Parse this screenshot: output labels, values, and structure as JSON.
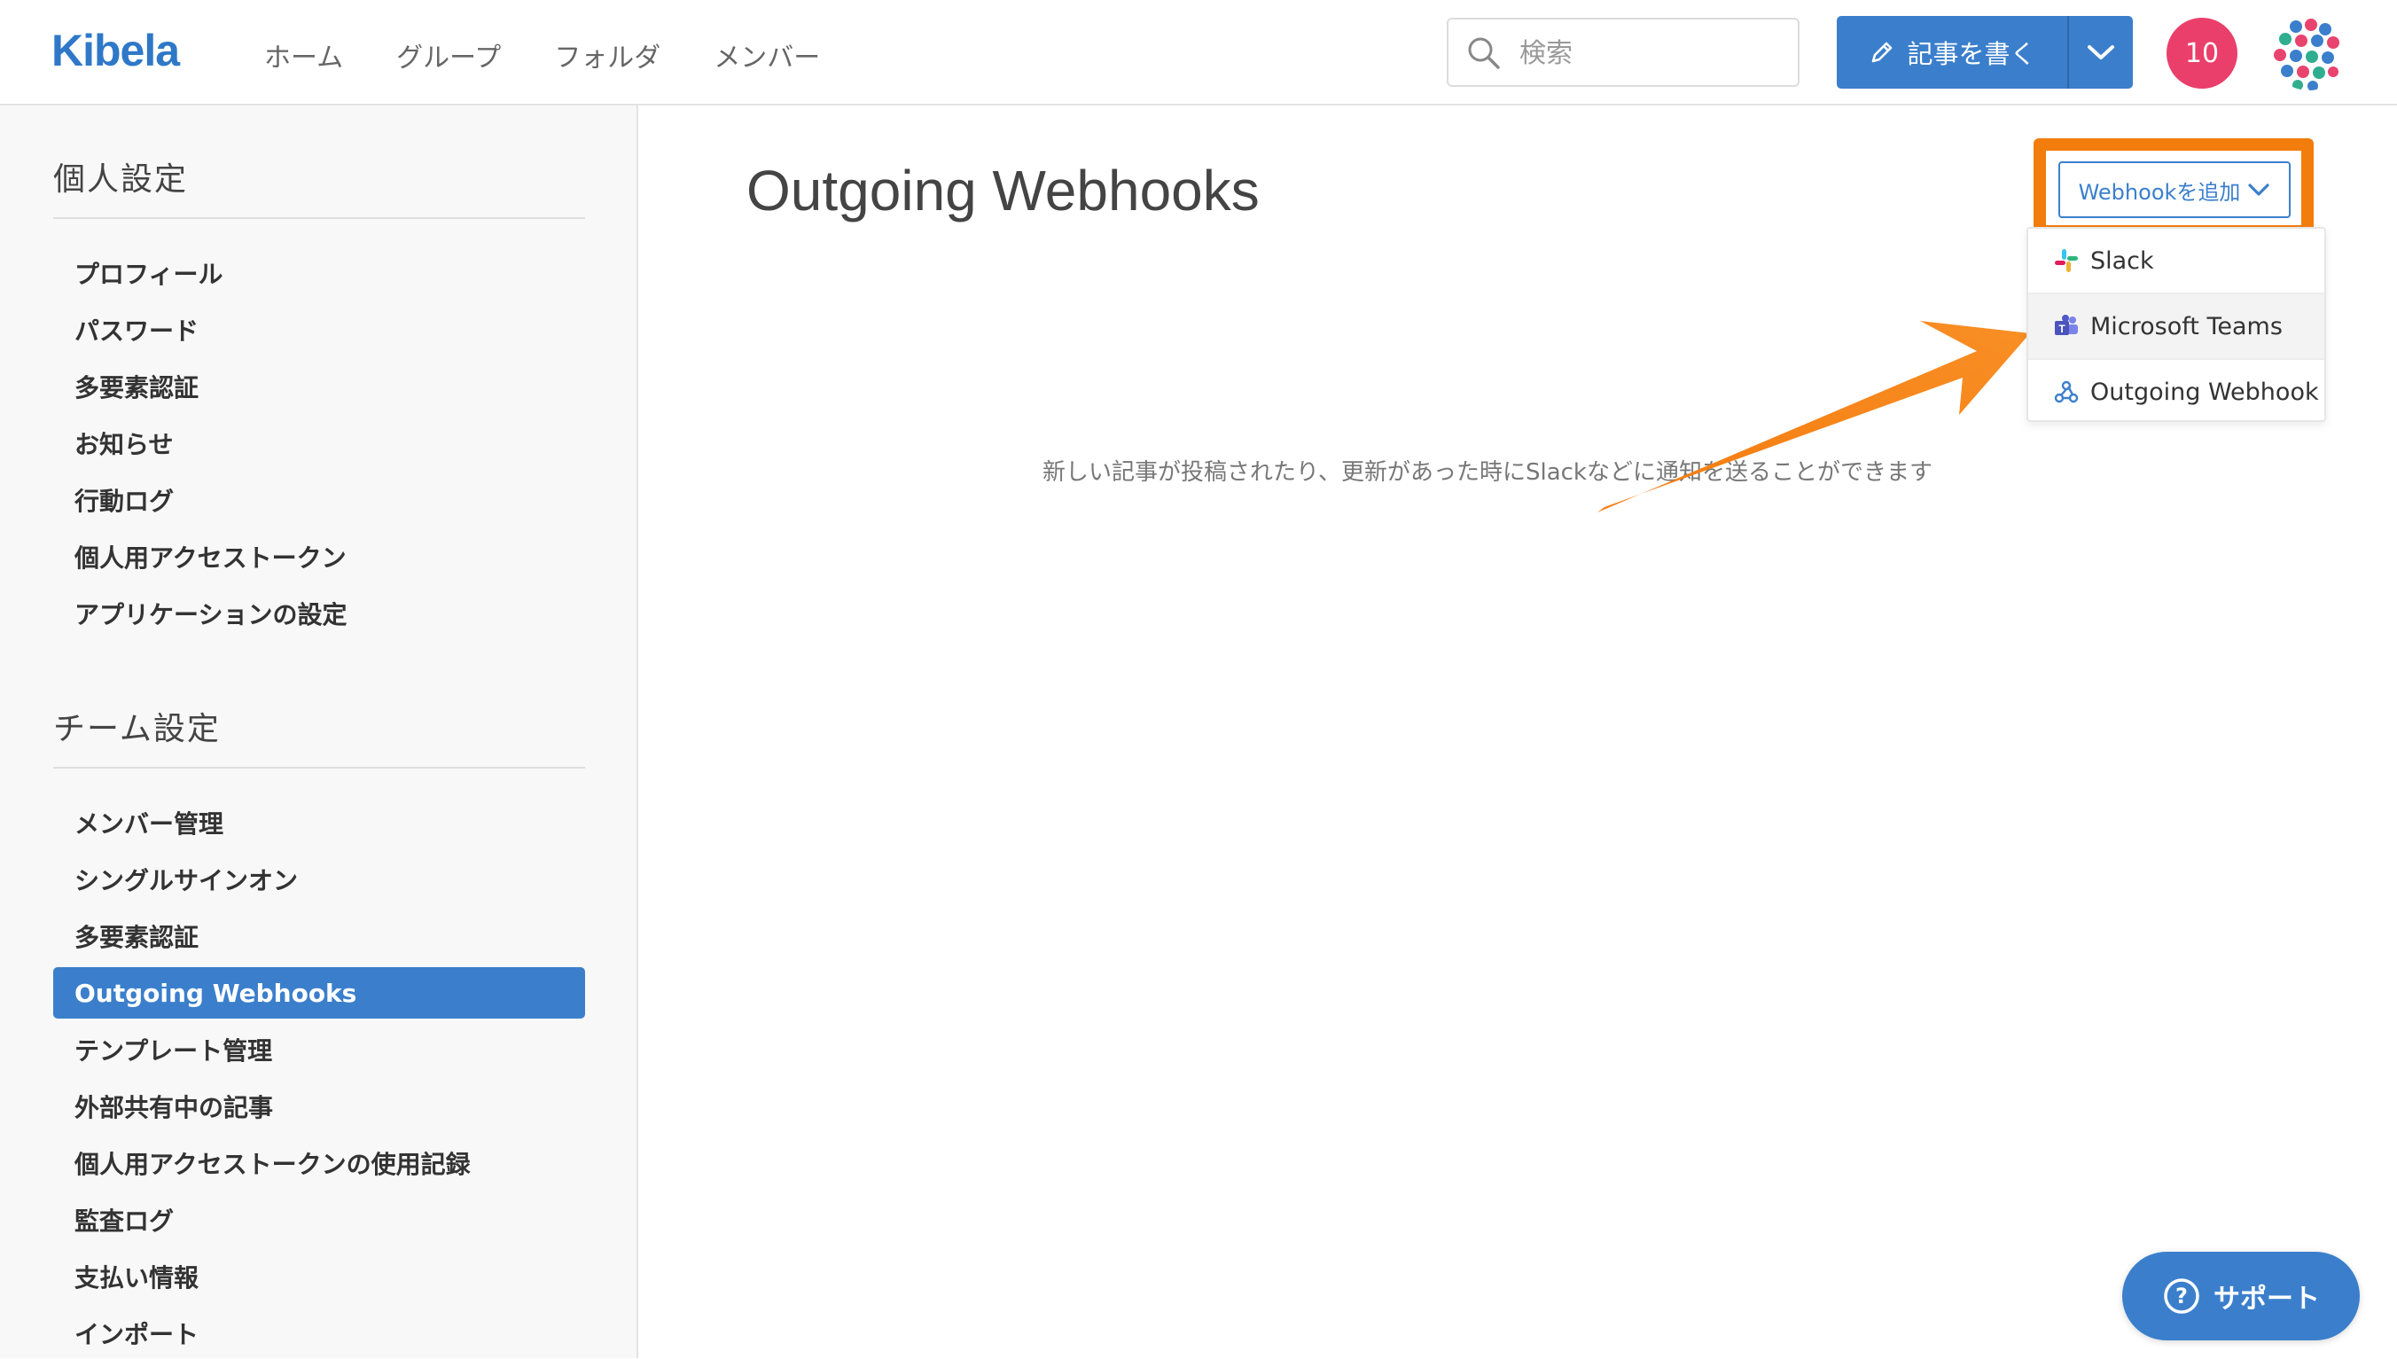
{
  "header": {
    "logo": "Kibela",
    "nav": [
      "ホーム",
      "グループ",
      "フォルダ",
      "メンバー"
    ],
    "search_placeholder": "検索",
    "write_label": "記事を書く",
    "notification_count": "10"
  },
  "sidebar": {
    "personal_title": "個人設定",
    "personal_items": [
      "プロフィール",
      "パスワード",
      "多要素認証",
      "お知らせ",
      "行動ログ",
      "個人用アクセストークン",
      "アプリケーションの設定"
    ],
    "team_title": "チーム設定",
    "team_items": [
      "メンバー管理",
      "シングルサインオン",
      "多要素認証",
      "Outgoing Webhooks",
      "テンプレート管理",
      "外部共有中の記事",
      "個人用アクセストークンの使用記録",
      "監査ログ",
      "支払い情報",
      "インポート"
    ],
    "active_item": "Outgoing Webhooks"
  },
  "main": {
    "title": "Outgoing Webhooks",
    "empty_message": "新しい記事が投稿されたり、更新があった時にSlackなどに通知を送ることができます",
    "add_button": "Webhookを追加",
    "dropdown_items": [
      "Slack",
      "Microsoft Teams",
      "Outgoing Webhook"
    ]
  },
  "support_label": "サポート",
  "colors": {
    "primary": "#3b7fcc",
    "highlight": "#f27d0c",
    "notification": "#ea3f6a"
  }
}
